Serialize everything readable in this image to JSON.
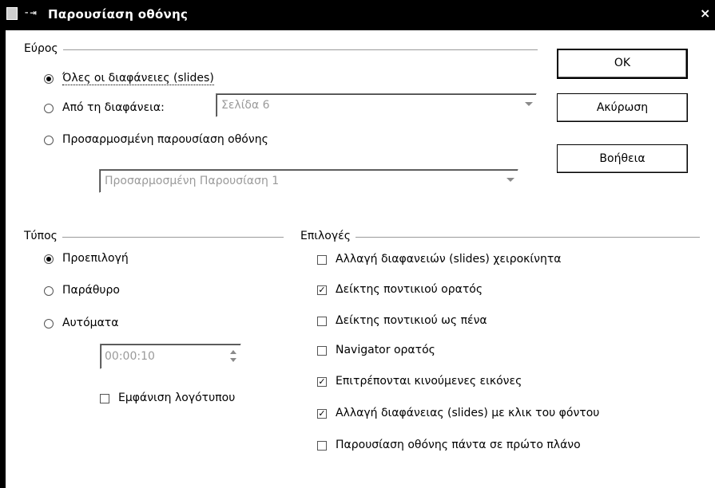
{
  "window": {
    "title": "Παρουσίαση οθόνης",
    "close_glyph": "×"
  },
  "range": {
    "label": "Εύρος",
    "options": [
      {
        "label": "Όλες οι διαφάνειες (slides)",
        "checked": true
      },
      {
        "label": "Από τη διαφάνεια:",
        "checked": false
      },
      {
        "label": "Προσαρμοσμένη παρουσίαση οθόνης",
        "checked": false
      }
    ],
    "slide_combo_value": "Σελίδα 6",
    "custom_combo_value": "Προσαρμοσμένη Παρουσίαση 1"
  },
  "type": {
    "label": "Τύπος",
    "options": [
      {
        "label": "Προεπιλογή",
        "checked": true
      },
      {
        "label": "Παράθυρο",
        "checked": false
      },
      {
        "label": "Αυτόματα",
        "checked": false
      }
    ],
    "duration_value": "00:00:10",
    "show_logo": {
      "label": "Εμφάνιση λογότυπου",
      "checked": false
    }
  },
  "options": {
    "label": "Επιλογές",
    "items": [
      {
        "label": "Αλλαγή διαφανειών (slides) χειροκίνητα",
        "checked": false
      },
      {
        "label": "Δείκτης ποντικιού ορατός",
        "checked": true
      },
      {
        "label": "Δείκτης ποντικιού ως πένα",
        "checked": false
      },
      {
        "label": "Navigator ορατός",
        "checked": false
      },
      {
        "label": "Επιτρέπονται κινούμενες εικόνες",
        "checked": true
      },
      {
        "label": "Αλλαγή διαφάνειας (slides) με κλικ του φόντου",
        "checked": true
      },
      {
        "label": "Παρουσίαση οθόνης πάντα σε πρώτο πλάνο",
        "checked": false
      }
    ]
  },
  "buttons": {
    "ok": "OK",
    "cancel": "Ακύρωση",
    "help": "Βοήθεια"
  },
  "icons": {
    "app": "presentation-app-icon",
    "pin": "pin-icon",
    "close": "close-icon"
  }
}
